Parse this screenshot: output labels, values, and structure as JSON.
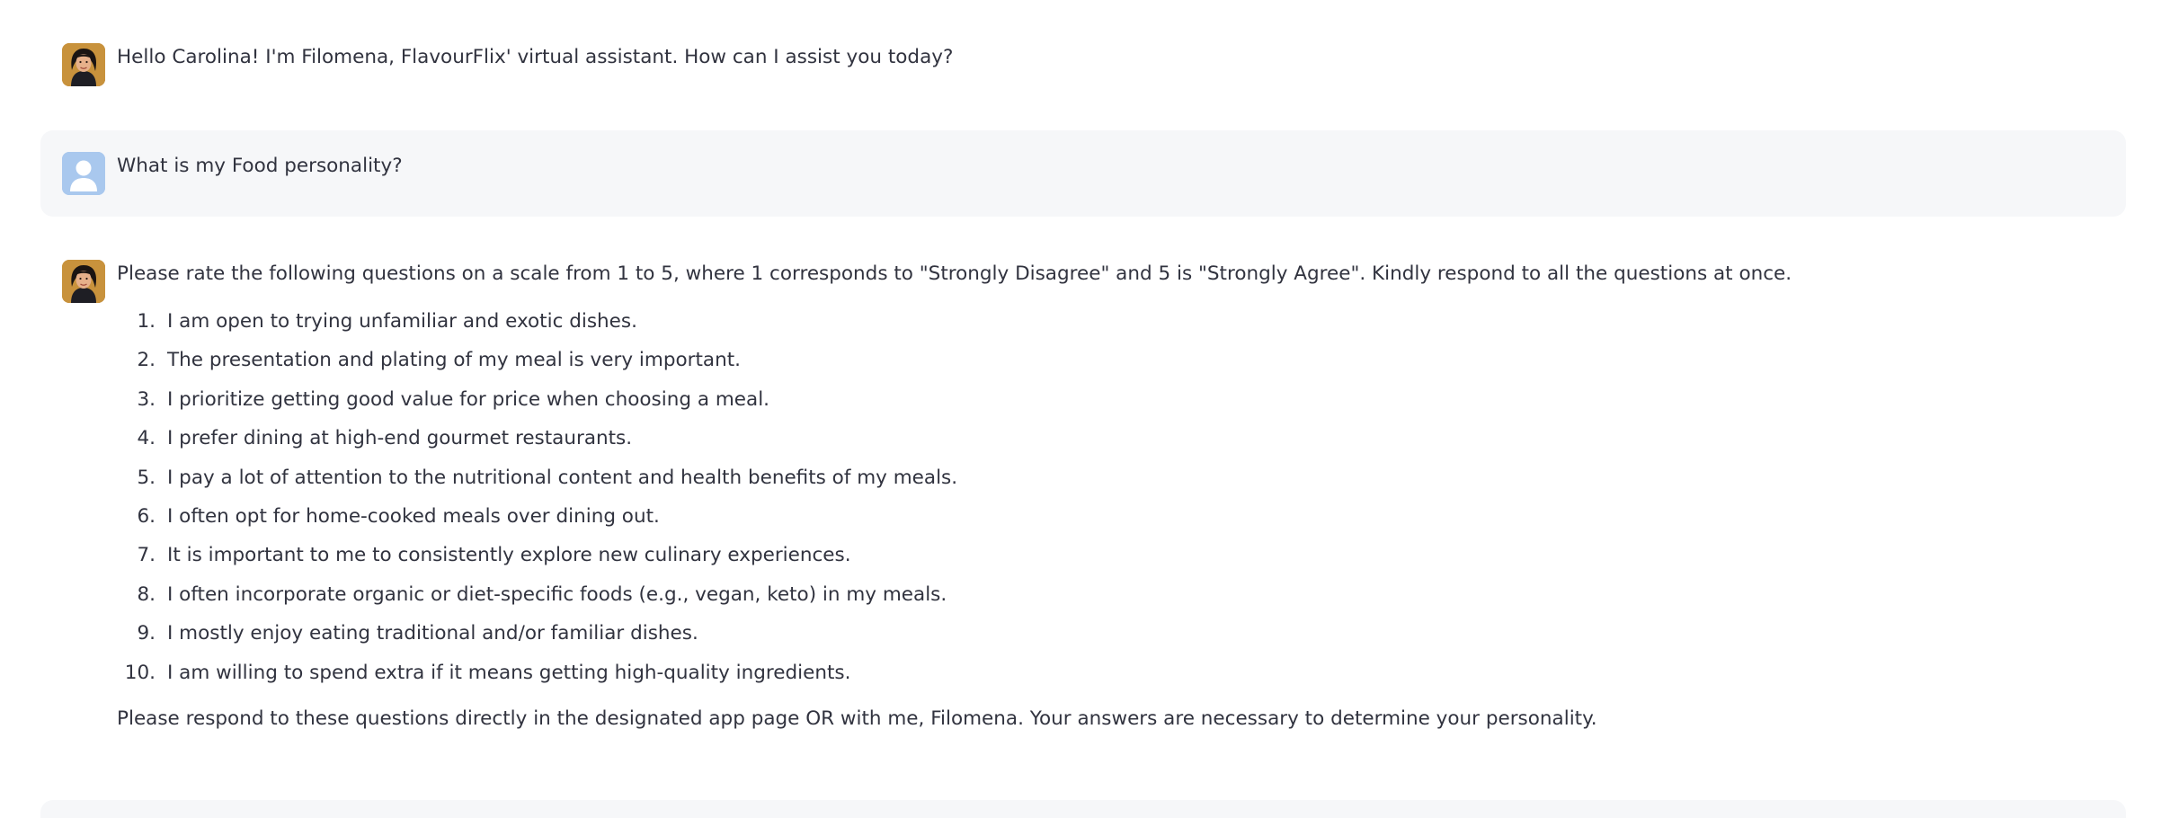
{
  "messages": [
    {
      "role": "assistant",
      "text": "Hello Carolina! I'm Filomena, FlavourFlix' virtual assistant. How can I assist you today?"
    },
    {
      "role": "user",
      "text": "What is my Food personality?"
    },
    {
      "role": "assistant",
      "intro": "Please rate the following questions on a scale from 1 to 5, where 1 corresponds to \"Strongly Disagree\" and 5 is \"Strongly Agree\". Kindly respond to all the questions at once.",
      "questions": [
        "I am open to trying unfamiliar and exotic dishes.",
        "The presentation and plating of my meal is very important.",
        "I prioritize getting good value for price when choosing a meal.",
        "I prefer dining at high-end gourmet restaurants.",
        "I pay a lot of attention to the nutritional content and health benefits of my meals.",
        "I often opt for home-cooked meals over dining out.",
        "It is important to me to consistently explore new culinary experiences.",
        "I often incorporate organic or diet-specific foods (e.g., vegan, keto) in my meals.",
        "I mostly enjoy eating traditional and/or familiar dishes.",
        "I am willing to spend extra if it means getting high-quality ingredients."
      ],
      "question_numbers": [
        "1.",
        "2.",
        "3.",
        "4.",
        "5.",
        "6.",
        "7.",
        "8.",
        "9.",
        "10."
      ],
      "outro": "Please respond to these questions directly in the designated app page OR with me, Filomena. Your answers are necessary to determine your personality."
    }
  ],
  "icons": {
    "assistant_avatar": "filomena-avatar-icon",
    "user_avatar": "user-avatar-icon"
  }
}
